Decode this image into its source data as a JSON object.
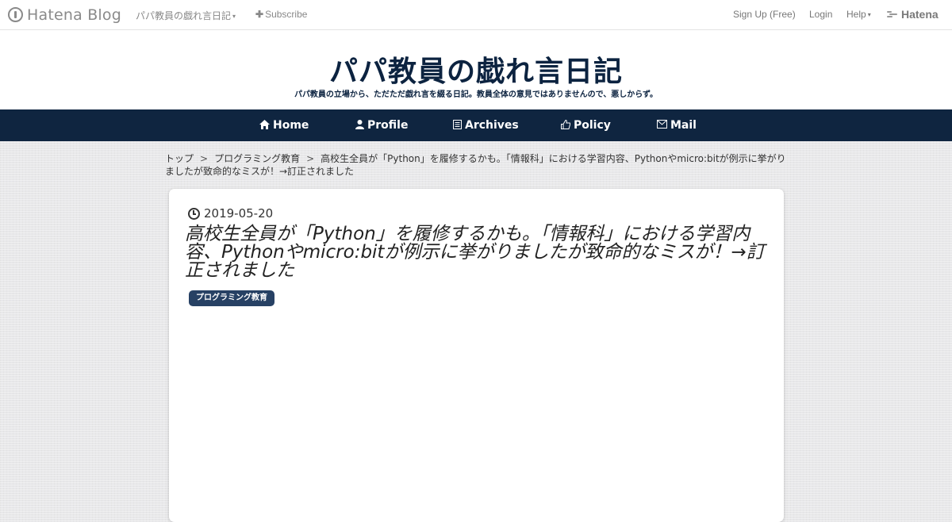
{
  "topbar": {
    "logo_text": "Hatena Blog",
    "blog_name": "パパ教員の戯れ言日記",
    "subscribe_label": "Subscribe",
    "signup_label": "Sign Up (Free)",
    "login_label": "Login",
    "help_label": "Help",
    "hatena_label": "Hatena"
  },
  "header": {
    "title": "パパ教員の戯れ言日記",
    "description": "パパ教員の立場から、ただただ戯れ言を綴る日記。教員全体の意見ではありませんので、悪しからず。"
  },
  "nav": {
    "items": [
      {
        "label": "Home",
        "icon": "home-icon"
      },
      {
        "label": "Profile",
        "icon": "user-icon"
      },
      {
        "label": "Archives",
        "icon": "archive-icon"
      },
      {
        "label": "Policy",
        "icon": "thumbs-up-icon"
      },
      {
        "label": "Mail",
        "icon": "mail-icon"
      }
    ]
  },
  "breadcrumb": {
    "items": [
      "トップ",
      "プログラミング教育",
      "高校生全員が「Python」を履修するかも。「情報科」における学習内容、Pythonやmicro:bitが例示に挙がりましたが致命的なミスが！→訂正されました"
    ],
    "separator": ">"
  },
  "article": {
    "date": "2019-05-20",
    "title": "高校生全員が「Python」を履修するかも。「情報科」における学習内容、Pythonやmicro:bitが例示に挙がりましたが致命的なミスが！→訂正されました",
    "category": "プログラミング教育"
  },
  "colors": {
    "navy": "#0f2540",
    "tag_bg": "#274164"
  }
}
